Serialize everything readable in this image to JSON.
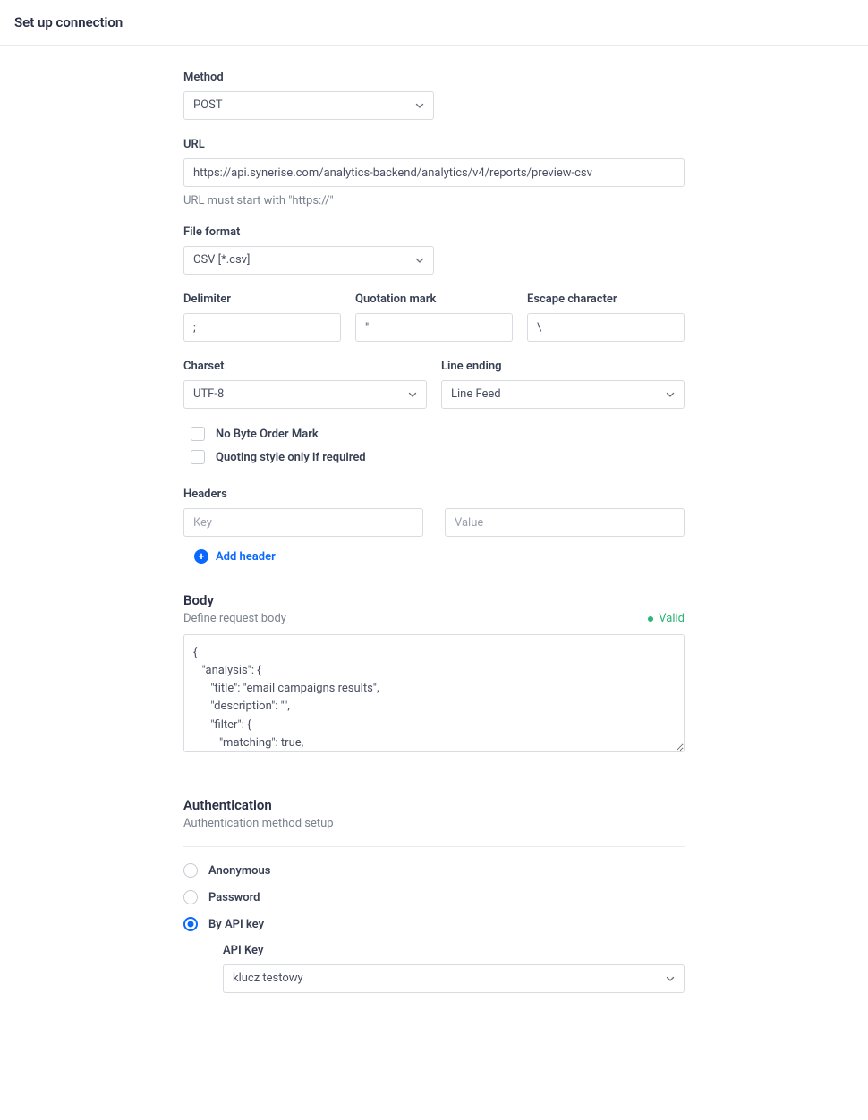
{
  "header": {
    "title": "Set up connection"
  },
  "method": {
    "label": "Method",
    "value": "POST"
  },
  "url": {
    "label": "URL",
    "value": "https://api.synerise.com/analytics-backend/analytics/v4/reports/preview-csv",
    "hint": "URL must start with \"https://\""
  },
  "fileFormat": {
    "label": "File format",
    "value": "CSV [*.csv]"
  },
  "delimiter": {
    "label": "Delimiter",
    "value": ";"
  },
  "quotation": {
    "label": "Quotation mark",
    "value": "\""
  },
  "escape": {
    "label": "Escape character",
    "value": "\\"
  },
  "charset": {
    "label": "Charset",
    "value": "UTF-8"
  },
  "lineEnding": {
    "label": "Line ending",
    "value": "Line Feed"
  },
  "noBom": {
    "label": "No Byte Order Mark",
    "checked": false
  },
  "quotingStyle": {
    "label": "Quoting style only if required",
    "checked": false
  },
  "headers": {
    "label": "Headers",
    "keyPlaceholder": "Key",
    "valuePlaceholder": "Value",
    "addLabel": "Add header"
  },
  "body": {
    "title": "Body",
    "subtitle": "Define request body",
    "validLabel": "Valid",
    "content": "{\n   \"analysis\": {\n      \"title\": \"email campaigns results\",\n      \"description\": \"\",\n      \"filter\": {\n         \"matching\": true,\n         \"expressions\": [],"
  },
  "auth": {
    "title": "Authentication",
    "subtitle": "Authentication method setup",
    "options": {
      "anonymous": "Anonymous",
      "password": "Password",
      "apiKey": "By API key"
    },
    "selected": "apiKey",
    "apiKeyLabel": "API Key",
    "apiKeyValue": "klucz testowy"
  }
}
